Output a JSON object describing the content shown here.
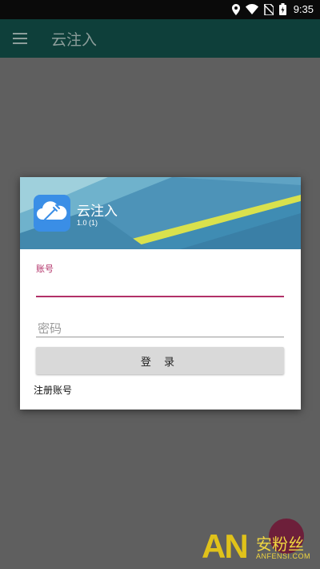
{
  "status_bar": {
    "time": "9:35",
    "icons": [
      "location-icon",
      "wifi-icon",
      "no-sim-icon",
      "battery-icon"
    ]
  },
  "app_bar": {
    "title": "云注入",
    "menu_icon": "menu-icon"
  },
  "dialog": {
    "app_name": "云注入",
    "version": "1.0 (1)",
    "account_label": "账号",
    "account_value": "",
    "password_placeholder": "密码",
    "password_value": "",
    "login_button": "登 录",
    "register_link": "注册账号"
  },
  "watermark": {
    "logo": "AN",
    "name": "安粉丝",
    "url": "ANFENSI.COM"
  },
  "colors": {
    "accent": "#b23168",
    "app_bar": "#0e3f3a",
    "scrim": "#5f5f5f",
    "header_blue": "#4a8fb5",
    "header_yellow": "#d8e04a"
  }
}
